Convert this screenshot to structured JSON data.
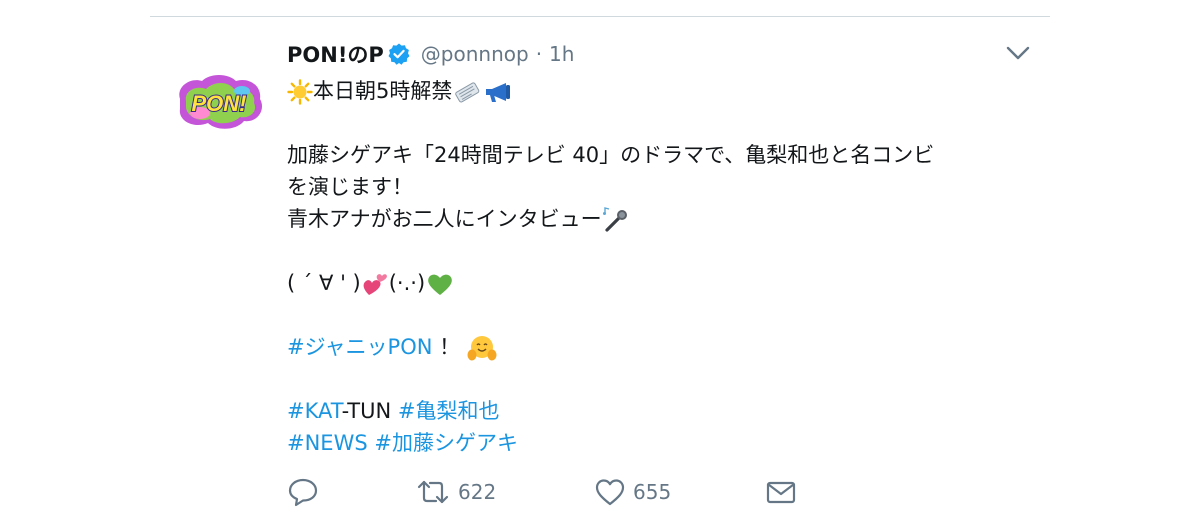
{
  "tweet": {
    "author_name": "PON!のP",
    "handle": "@ponnnop",
    "separator": "·",
    "time": "1h",
    "avatar_text": "PON!",
    "lines": {
      "l1": "本日朝5時解禁",
      "l2": "加藤シゲアキ「24時間テレビ 40」のドラマで、亀梨和也と名コンビ",
      "l3": "を演じます！",
      "l4": "青木アナがお二人にインタビュー",
      "l5a": "( ´ ∀ ' )",
      "l5b": "(·.·)",
      "l6_tag": "#ジャニッPON",
      "l6_rest": "！",
      "l7_tag1": "#KAT",
      "l7_rest": "-TUN",
      "l7_tag2": "#亀梨和也",
      "l8_tag1": "#NEWS",
      "l8_tag2": "#加藤シゲアキ"
    },
    "emojis": [
      "sun-emoji",
      "newspaper-emoji",
      "megaphone-emoji",
      "microphone-emoji",
      "two-hearts-emoji",
      "green-heart-emoji",
      "hugging-face-emoji"
    ],
    "actions": {
      "retweets": "622",
      "likes": "655"
    },
    "colors": {
      "link": "#1b95e0",
      "meta": "#657786",
      "verified": "#1da1f2",
      "text": "#14171a"
    }
  }
}
